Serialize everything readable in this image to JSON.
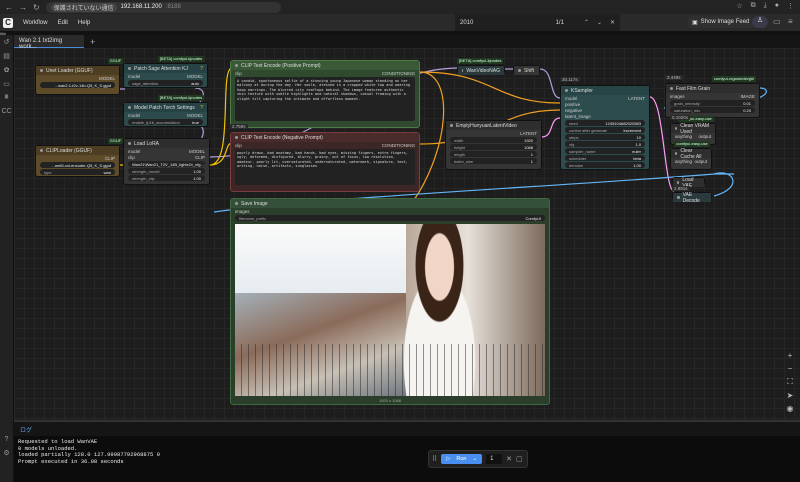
{
  "browser": {
    "security_label": "保護されていない通信",
    "host": "192.168.11.200",
    "port": ":8188"
  },
  "menu": {
    "logo": "C",
    "items": [
      "Workflow",
      "Edit",
      "Help"
    ]
  },
  "find": {
    "query": "2010",
    "count": "1/1"
  },
  "show_image_feed": "Show Image Feed",
  "title_strip": "title",
  "tab": {
    "label": "Wan 2.1 txt2img work...",
    "add": "+"
  },
  "nodes": [
    {
      "title": "Unet Loader (GGUF)",
      "badge": "GGUF",
      "outputs": [
        "MODEL"
      ],
      "widgets": [
        {
          "label": "",
          "value": "...wan2.1-t2v-14b-Q5_K_S.gguf"
        }
      ]
    },
    {
      "title": "Patch Sage Attention KJ",
      "badge": "[BETA] comfyui-kjnodes",
      "inputs": [
        "model"
      ],
      "outputs": [
        "MODEL"
      ],
      "widgets": [
        {
          "label": "sage_attention",
          "value": "auto"
        }
      ]
    },
    {
      "title": "Model Patch Torch Settings",
      "badge": "[BETA] comfyui-kjnodes",
      "inputs": [
        "model"
      ],
      "outputs": [
        "MODEL"
      ],
      "widgets": [
        {
          "label": "enable_fp16_accumulation",
          "value": "true"
        }
      ]
    },
    {
      "title": "CLIPLoader (GGUF)",
      "badge": "GGUF",
      "outputs": [
        "CLIP"
      ],
      "widgets": [
        {
          "label": "",
          "value": "...umt5-xxl-encoder-Q5_K_S.gguf"
        },
        {
          "label": "type",
          "value": "wan"
        }
      ]
    },
    {
      "title": "Load LoRA",
      "inputs": [
        "model",
        "clip"
      ],
      "outputs": [
        "MODEL",
        "CLIP"
      ],
      "widgets": [
        {
          "label": "",
          "value": "Wan21\\Wan21_T2V_14B_lightx2v_cfg..."
        },
        {
          "label": "strength_model",
          "value": "1.00"
        },
        {
          "label": "strength_clip",
          "value": "1.00"
        }
      ]
    },
    {
      "title": "CLIP Text Encode (Positive Prompt)",
      "inputs": [
        "clip"
      ],
      "outputs": [
        "CONDITIONING"
      ],
      "text": "A candid, spontaneous selfie of a stunning young Japanese woman standing on her balcony at during the day. Her smile, dressed in a cropped white top and wearing hoop earrings. The blurred city rooftops behind. The image features authentic skin texture with subtle highlights and natural shadows, casual framing with a slight tilt capturing the intimate and effortless moment."
    },
    {
      "title": "CLIP Text Encode (Negative Prompt)",
      "timing": "2.759s",
      "inputs": [
        "clip"
      ],
      "outputs": [
        "CONDITIONING"
      ],
      "text": "poorly drawn, bad anatomy, bad hands, bad eyes, missing fingers, extra fingers, ugly, deformed, disfigured, blurry, grainy, out of focus, low resolution, amateur, poorly lit, oversaturated, undersaturated, watermark, signature, text, writing, noise, artifacts, sunglasses"
    },
    {
      "title": "Save Image",
      "inputs": [
        "images"
      ],
      "widgets": [
        {
          "label": "filename_prefix",
          "value": "ComfyUI"
        }
      ],
      "image_caption": "1920 x 1088"
    },
    {
      "title": "WanVideoNAG",
      "badge": "[BETA] comfyui-kjnodes"
    },
    {
      "title": "Shift"
    },
    {
      "title": "EmptyHunyuanLatentVideo",
      "outputs": [
        "LATENT"
      ],
      "widgets": [
        {
          "label": "width",
          "value": "1920"
        },
        {
          "label": "height",
          "value": "1088"
        },
        {
          "label": "length",
          "value": "1"
        },
        {
          "label": "batch_size",
          "value": "1"
        }
      ]
    },
    {
      "title": "KSampler",
      "timing": "30.117s",
      "inputs": [
        "model",
        "positive",
        "negative",
        "latent_image"
      ],
      "outputs": [
        "LATENT"
      ],
      "widgets": [
        {
          "label": "seed",
          "value": "1245104682020583"
        },
        {
          "label": "control after generate",
          "value": "increment"
        },
        {
          "label": "steps",
          "value": "10"
        },
        {
          "label": "cfg",
          "value": "1.0"
        },
        {
          "label": "sampler_name",
          "value": "euler"
        },
        {
          "label": "scheduler",
          "value": "beta"
        },
        {
          "label": "denoise",
          "value": "1.00"
        }
      ]
    },
    {
      "title": "Fast Film Grain",
      "timing": "2.449s",
      "badge": "comfyui-vrgamedevgirl",
      "inputs": [
        "images"
      ],
      "outputs": [
        "IMAGE"
      ],
      "widgets": [
        {
          "label": "grain_intensity",
          "value": "0.01"
        },
        {
          "label": "saturation_mix",
          "value": "0.20"
        }
      ]
    },
    {
      "title": "Clean VRAM Used",
      "timing": "0.1020s",
      "badge": "comfyui-easy-use",
      "inputs": [
        "anything"
      ],
      "outputs": [
        "output"
      ]
    },
    {
      "title": "Clear Cache All",
      "badge": "comfyui-easy-use",
      "inputs": [
        "anything"
      ],
      "outputs": [
        "output"
      ]
    },
    {
      "title": "Load VAE",
      "timing": "2.991s"
    },
    {
      "title": "VAE Decode"
    }
  ],
  "log": {
    "title": "ログ",
    "lines": [
      "Requested to load WanVAE",
      "0 models unloaded.",
      "loaded partially 128.0 127.99987792968875 0",
      "Prompt executed in 36.08 seconds"
    ]
  },
  "run": {
    "label": "Run",
    "count": "1"
  },
  "colors": {
    "accent": "#4a8ef0",
    "link_model": "#b39ddb",
    "link_clip": "#f2c200",
    "link_cond": "#f0a020",
    "link_image": "#64b5f6",
    "link_latent": "#ff9cf9"
  }
}
